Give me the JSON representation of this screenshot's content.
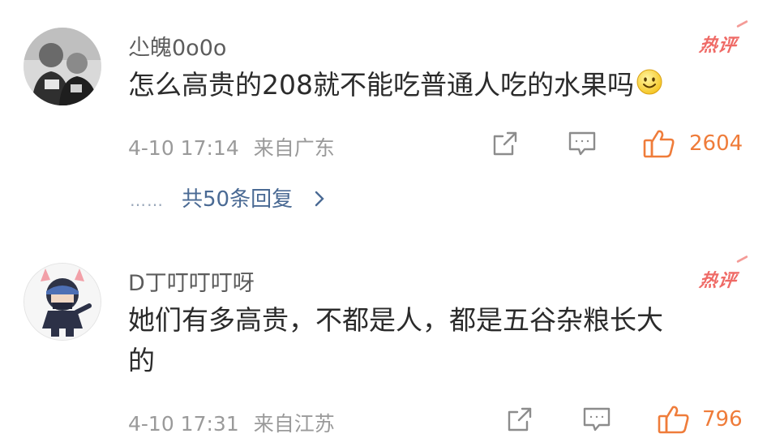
{
  "comments": [
    {
      "username": "尐魄0o0o",
      "hot_label": "热评",
      "text_lines": [
        "怎么高贵的208就不能吃普通人吃的水果吗"
      ],
      "emoji": "smile-emoji",
      "date": "4-10 17:14",
      "location": "来自广东",
      "likes": "2604",
      "replies": {
        "dots": "……",
        "label": "共50条回复"
      }
    },
    {
      "username": "D丁叮叮叮呀",
      "hot_label": "热评",
      "text_lines": [
        "她们有多高贵，不都是人，都是五谷杂粮长大",
        "的"
      ],
      "date": "4-10 17:31",
      "location": "来自江苏",
      "likes": "796"
    }
  ],
  "icons": [
    "share-icon",
    "comment-icon",
    "like-icon",
    "chevron-right-icon"
  ],
  "colors": {
    "like": "#ef7c3a",
    "reply_link": "#4a6a94",
    "hot": "#ef6a66",
    "meta": "#9a9a9a"
  }
}
